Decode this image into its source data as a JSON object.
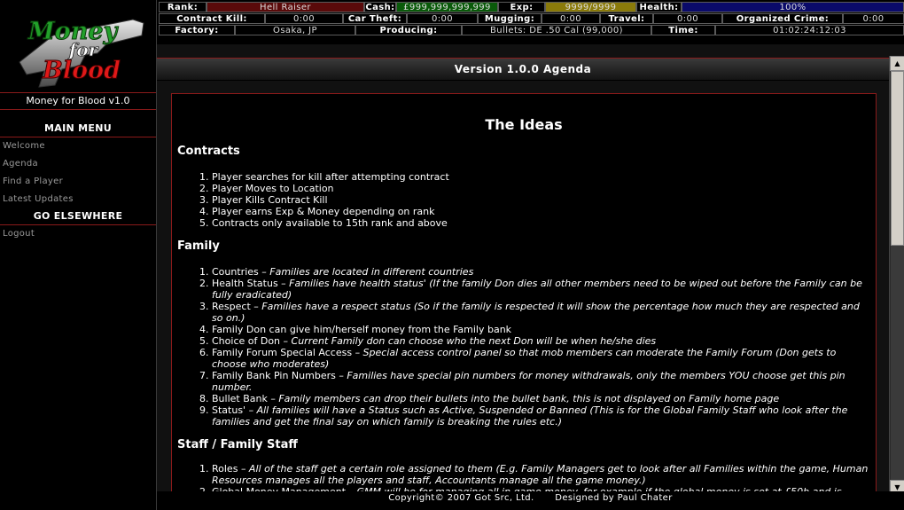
{
  "logo": {
    "line1": "Money",
    "line2": "for",
    "line3": "Blood"
  },
  "site": {
    "version_label": "Money for Blood v1.0"
  },
  "menu": {
    "main_heading": "MAIN MENU",
    "main_items": [
      {
        "label": "Welcome"
      },
      {
        "label": "Agenda"
      },
      {
        "label": "Find a Player"
      },
      {
        "label": "Latest Updates"
      }
    ],
    "else_heading": "GO ELSEWHERE",
    "else_items": [
      {
        "label": "Logout"
      }
    ]
  },
  "stats": {
    "rank_label": "Rank:",
    "rank_value": "Hell Raiser",
    "cash_label": "Cash:",
    "cash_value": "£999,999,999,999",
    "exp_label": "Exp:",
    "exp_value": "9999/9999",
    "health_label": "Health:",
    "health_value": "100%",
    "contract_kill_label": "Contract Kill:",
    "contract_kill_value": "0:00",
    "car_theft_label": "Car Theft:",
    "car_theft_value": "0:00",
    "mugging_label": "Mugging:",
    "mugging_value": "0:00",
    "travel_label": "Travel:",
    "travel_value": "0:00",
    "organized_crime_label": "Organized Crime:",
    "organized_crime_value": "0:00",
    "factory_label": "Factory:",
    "factory_value": "Osaka, JP",
    "producing_label": "Producing:",
    "producing_value": "Bullets: DE .50 Cal (99,000)",
    "time_label": "Time:",
    "time_value": "01:02:24:12:03",
    "colors": {
      "rank": "#5a0a0a",
      "cash": "#0a5a0a",
      "exp": "#8a7a0a",
      "health": "#0a0a6a"
    }
  },
  "page": {
    "title": "Version 1.0.0 Agenda",
    "heading": "The Ideas",
    "sections": [
      {
        "title": "Contracts",
        "items": [
          {
            "lead": "Player searches for kill after attempting contract"
          },
          {
            "lead": "Player Moves to Location"
          },
          {
            "lead": "Player Kills Contract Kill"
          },
          {
            "lead": "Player earns Exp & Money depending on rank"
          },
          {
            "lead": "Contracts only available to 15th rank and above"
          }
        ]
      },
      {
        "title": "Family",
        "items": [
          {
            "lead": "Countries",
            "desc": "– Families are located in different countries"
          },
          {
            "lead": "Health Status",
            "desc": "– Families have health status' (If the family Don dies all other members need to be wiped out before the Family can be fully eradicated)"
          },
          {
            "lead": "Respect",
            "desc": "– Families have a respect status (So if the family is respected it will show the percentage how much they are respected and so on.)"
          },
          {
            "lead": "Family Don can give him/herself money from the Family bank"
          },
          {
            "lead": "Choice of Don",
            "desc": "– Current Family don can choose who the next Don will be when he/she dies"
          },
          {
            "lead": "Family Forum Special Access",
            "desc": "– Special access control panel so that mob members can moderate the Family Forum (Don gets to choose who moderates)"
          },
          {
            "lead": "Family Bank Pin Numbers",
            "desc": "– Families have special pin numbers for money withdrawals, only the members YOU choose get this pin number."
          },
          {
            "lead": "Bullet Bank",
            "desc": "– Family members can drop their bullets into the bullet bank, this is not displayed on Family home page"
          },
          {
            "lead": "Status'",
            "desc": "– All families will have a Status such as Active, Suspended or Banned (This is for the Global Family Staff who look after the families and get the final say on which family is breaking the rules etc.)"
          }
        ]
      },
      {
        "title": "Staff / Family Staff",
        "items": [
          {
            "lead": "Roles",
            "desc": "– All of the staff get a certain role assigned to them (E.g. Family Managers get to look after all Families within the game, Human Resources manages all the players and staff, Accountants manage all the game money.)"
          },
          {
            "lead": "Global Money Management",
            "desc": "– GMM will be for managing all in game money, for example if the global money is set at £50b and is"
          }
        ]
      }
    ]
  },
  "footer": {
    "copyright": "Copyright© 2007 Got Src, Ltd.",
    "designer": "Designed by Paul Chater"
  }
}
